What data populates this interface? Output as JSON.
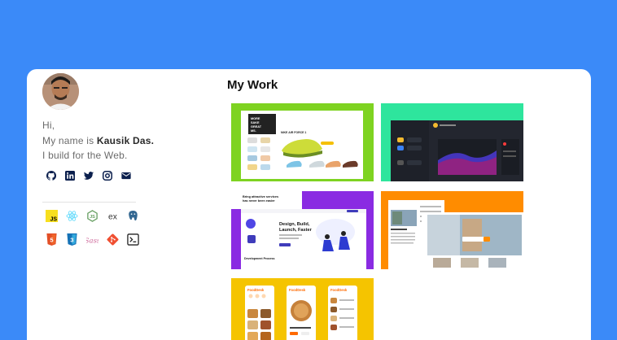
{
  "intro": {
    "greeting": "Hi,",
    "name_prefix": "My name is ",
    "name": "Kausik Das.",
    "tagline": "I build for the Web."
  },
  "social_icons": [
    "github-icon",
    "linkedin-icon",
    "twitter-icon",
    "instagram-icon",
    "email-icon"
  ],
  "tech_icons_row1": [
    "javascript-icon",
    "react-icon",
    "nodejs-icon",
    "express-icon",
    "postgresql-icon"
  ],
  "tech_icons_row2": [
    "html5-icon",
    "css3-icon",
    "sass-icon",
    "git-icon",
    "terminal-icon"
  ],
  "main": {
    "title": "My Work"
  },
  "projects": [
    {
      "name": "nike-store",
      "bg": "#7ed321",
      "lines": [
        "MORE",
        "SAKE",
        "GREAT",
        "MS.",
        "NIKE AIR FORCE 1"
      ]
    },
    {
      "name": "crypto-dashboard",
      "bg": "#2ee59d"
    },
    {
      "name": "agency-landing",
      "bg": "#8a2be2",
      "lines": [
        "Bring attractive services",
        "has never been easier",
        "Design, Build,",
        "Launch, Faster",
        "Development Process"
      ]
    },
    {
      "name": "real-estate",
      "bg": "#ff8c00"
    },
    {
      "name": "food-app",
      "bg": "#f5c400",
      "lines": [
        "FoodDesk",
        "FoodDesk",
        "FoodDesk"
      ]
    }
  ],
  "colors": {
    "background": "#3b8af8",
    "card": "#ffffff"
  }
}
